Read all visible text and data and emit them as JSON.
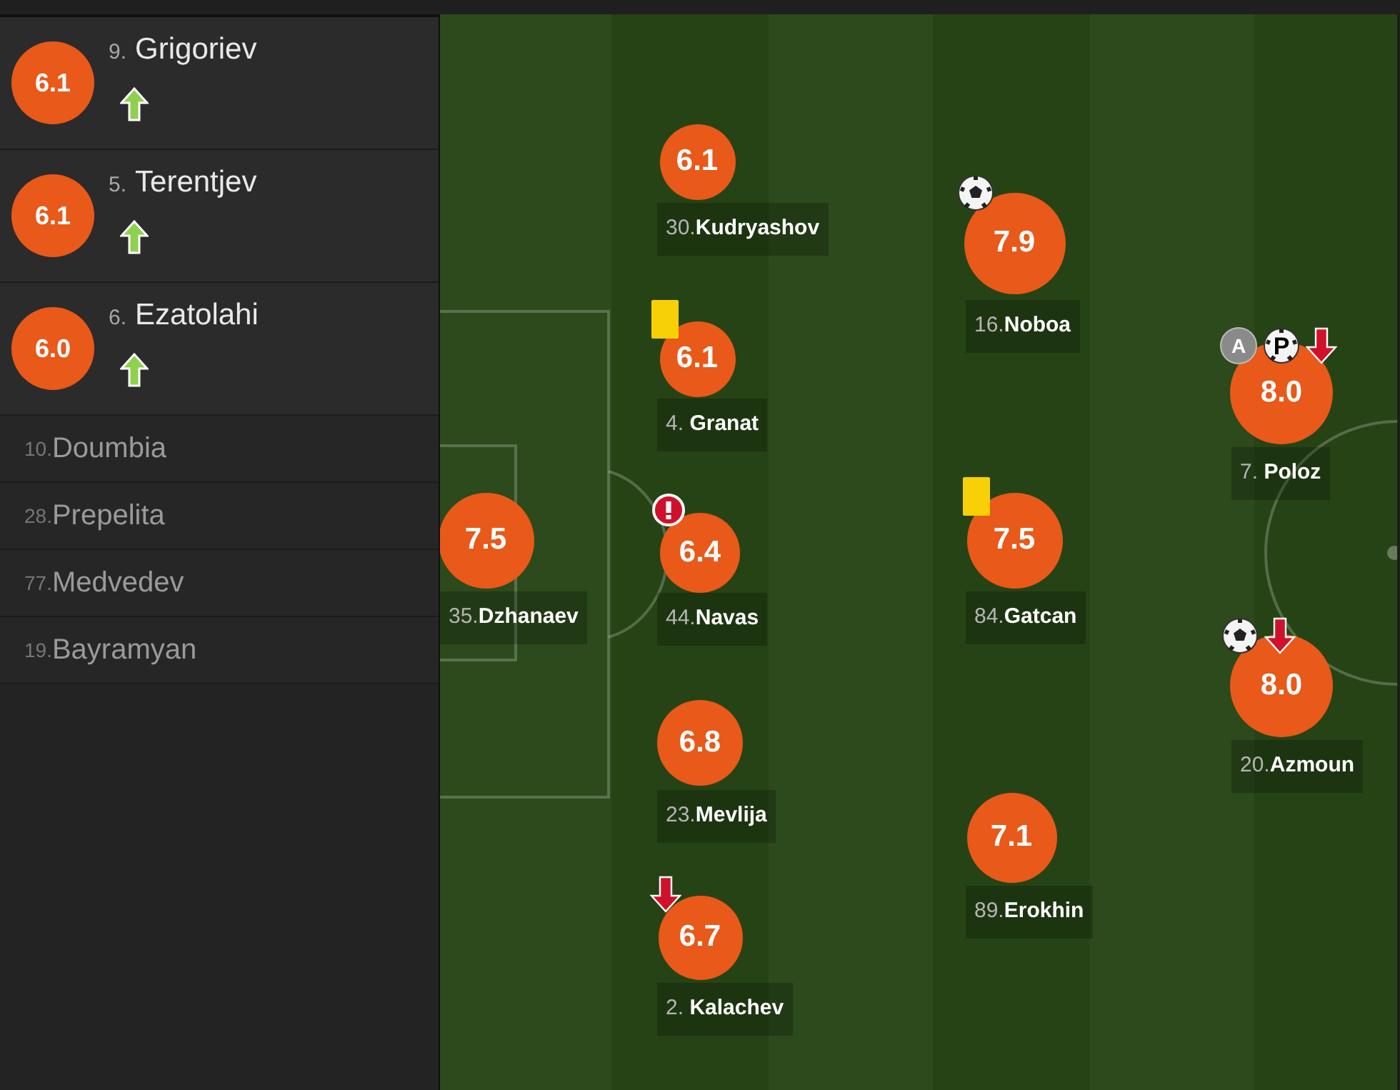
{
  "substitutes": [
    {
      "kind": "rated",
      "rating": "6.1",
      "number": "9.",
      "name": "Grigoriev",
      "subbed_in": true
    },
    {
      "kind": "rated",
      "rating": "6.1",
      "number": "5.",
      "name": "Terentjev",
      "subbed_in": true
    },
    {
      "kind": "rated",
      "rating": "6.0",
      "number": "6.",
      "name": "Ezatolahi",
      "subbed_in": true
    },
    {
      "kind": "unused",
      "number": "10.",
      "name": "Doumbia"
    },
    {
      "kind": "unused",
      "number": "28.",
      "name": "Prepelita"
    },
    {
      "kind": "unused",
      "number": "77.",
      "name": "Medvedev"
    },
    {
      "kind": "unused",
      "number": "19.",
      "name": "Bayramyan"
    }
  ],
  "pitch_players": [
    {
      "number": "35.",
      "name": "Dzhanaev",
      "rating": "7.5"
    },
    {
      "number": "30.",
      "name": "Kudryashov",
      "rating": "6.1"
    },
    {
      "number": "4. ",
      "name": "Granat",
      "rating": "6.1",
      "events": [
        {
          "kind": "yellow_card"
        }
      ]
    },
    {
      "number": "44.",
      "name": "Navas",
      "rating": "6.4",
      "events": [
        {
          "kind": "error"
        }
      ]
    },
    {
      "number": "23.",
      "name": "Mevlija",
      "rating": "6.8"
    },
    {
      "number": "2. ",
      "name": "Kalachev",
      "rating": "6.7",
      "events": [
        {
          "kind": "sub_off"
        }
      ]
    },
    {
      "number": "16.",
      "name": "Noboa",
      "rating": "7.9",
      "events": [
        {
          "kind": "goal"
        }
      ]
    },
    {
      "number": "84.",
      "name": "Gatcan",
      "rating": "7.5",
      "events": [
        {
          "kind": "yellow_card"
        }
      ]
    },
    {
      "number": "89.",
      "name": "Erokhin",
      "rating": "7.1"
    },
    {
      "number": "7. ",
      "name": "Poloz",
      "rating": "8.0",
      "events": [
        {
          "kind": "captain",
          "label": "A"
        },
        {
          "kind": "penalty_goal",
          "label": "P"
        },
        {
          "kind": "sub_off"
        }
      ]
    },
    {
      "number": "20.",
      "name": "Azmoun",
      "rating": "8.0",
      "events": [
        {
          "kind": "goal"
        },
        {
          "kind": "sub_off"
        }
      ]
    }
  ]
}
